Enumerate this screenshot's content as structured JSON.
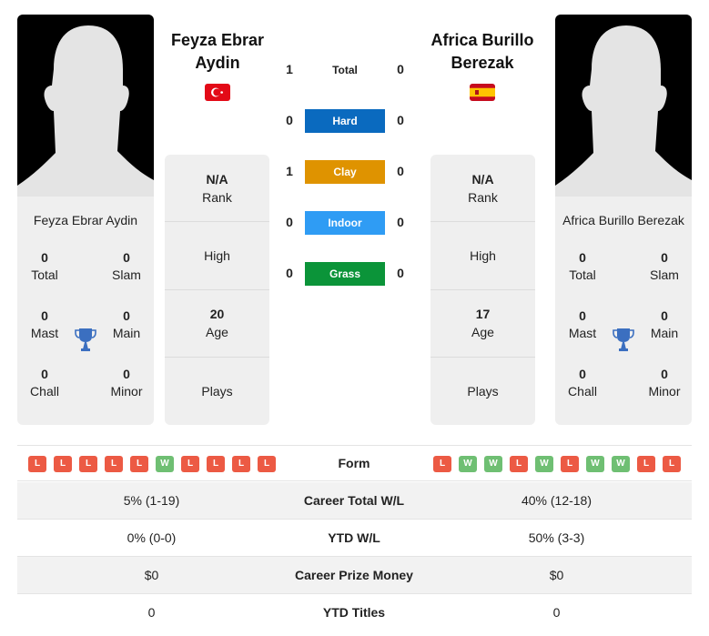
{
  "players": {
    "left": {
      "name": "Feyza Ebrar Aydin",
      "heading_line1": "Feyza Ebrar",
      "heading_line2": "Aydin",
      "country": "Turkey",
      "flag_icon": "turkey-flag-icon",
      "titles": {
        "total": {
          "value": "0",
          "label": "Total"
        },
        "slam": {
          "value": "0",
          "label": "Slam"
        },
        "mast": {
          "value": "0",
          "label": "Mast"
        },
        "main": {
          "value": "0",
          "label": "Main"
        },
        "chall": {
          "value": "0",
          "label": "Chall"
        },
        "minor": {
          "value": "0",
          "label": "Minor"
        }
      },
      "stats": {
        "rank": {
          "value": "N/A",
          "label": "Rank"
        },
        "high": {
          "value": "",
          "label": "High"
        },
        "age": {
          "value": "20",
          "label": "Age"
        },
        "plays": {
          "value": "",
          "label": "Plays"
        }
      },
      "form": [
        "L",
        "L",
        "L",
        "L",
        "L",
        "W",
        "L",
        "L",
        "L",
        "L"
      ]
    },
    "right": {
      "name": "Africa Burillo Berezak",
      "heading_line1": "Africa Burillo",
      "heading_line2": "Berezak",
      "country": "Spain",
      "flag_icon": "spain-flag-icon",
      "titles": {
        "total": {
          "value": "0",
          "label": "Total"
        },
        "slam": {
          "value": "0",
          "label": "Slam"
        },
        "mast": {
          "value": "0",
          "label": "Mast"
        },
        "main": {
          "value": "0",
          "label": "Main"
        },
        "chall": {
          "value": "0",
          "label": "Chall"
        },
        "minor": {
          "value": "0",
          "label": "Minor"
        }
      },
      "stats": {
        "rank": {
          "value": "N/A",
          "label": "Rank"
        },
        "high": {
          "value": "",
          "label": "High"
        },
        "age": {
          "value": "17",
          "label": "Age"
        },
        "plays": {
          "value": "",
          "label": "Plays"
        }
      },
      "form": [
        "L",
        "W",
        "W",
        "L",
        "W",
        "L",
        "W",
        "W",
        "L",
        "L"
      ]
    }
  },
  "h2h": [
    {
      "surface": "Total",
      "left": "1",
      "right": "0",
      "color": ""
    },
    {
      "surface": "Hard",
      "left": "0",
      "right": "0",
      "color": "#0a6abf"
    },
    {
      "surface": "Clay",
      "left": "1",
      "right": "0",
      "color": "#df9300"
    },
    {
      "surface": "Indoor",
      "left": "0",
      "right": "0",
      "color": "#2f9cf4"
    },
    {
      "surface": "Grass",
      "left": "0",
      "right": "0",
      "color": "#0b9439"
    }
  ],
  "form_label": "Form",
  "comparison": [
    {
      "label": "Career Total W/L",
      "left": "5% (1-19)",
      "right": "40% (12-18)"
    },
    {
      "label": "YTD W/L",
      "left": "0% (0-0)",
      "right": "50% (3-3)"
    },
    {
      "label": "Career Prize Money",
      "left": "$0",
      "right": "$0"
    },
    {
      "label": "YTD Titles",
      "left": "0",
      "right": "0"
    }
  ],
  "colors": {
    "loss": "#ec5a44",
    "win": "#6fbf73",
    "trophy": "#3b6fc0",
    "panel_bg": "#efefef"
  }
}
